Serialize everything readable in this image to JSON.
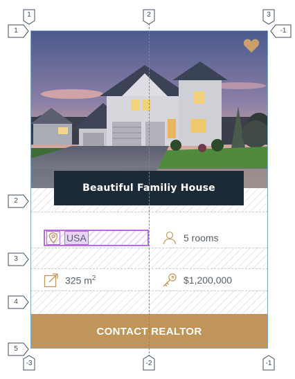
{
  "card": {
    "title": "Beautiful Familiy House",
    "country": "USA",
    "rooms": "5 rooms",
    "area": "325 m",
    "area_unit_sup": "2",
    "price": "$1,200,000",
    "cta_label": "CONTACT REALTOR",
    "favorite_icon": "heart-icon",
    "colors": {
      "title_bg": "#1c2a37",
      "accent": "#c09559",
      "heart": "#c9a06a",
      "selection": "#b86ae0"
    }
  },
  "guides": {
    "top": [
      "1",
      "2",
      "3"
    ],
    "bottom": [
      "-3",
      "-2",
      "-1"
    ],
    "left": [
      "1",
      "2",
      "3",
      "4",
      "5"
    ],
    "right": [
      "-1"
    ]
  }
}
